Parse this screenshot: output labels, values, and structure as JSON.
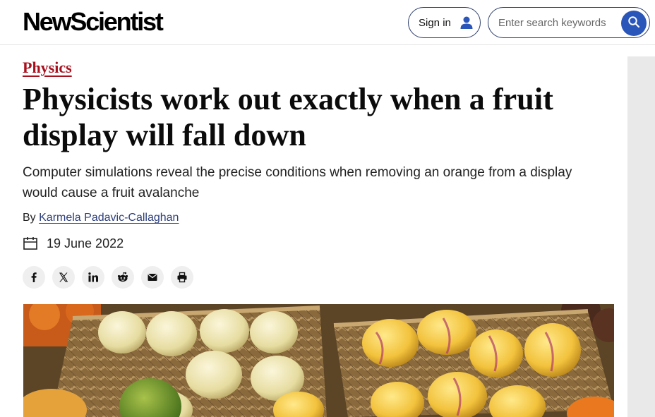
{
  "header": {
    "logo_text": "NewScientist",
    "signin_label": "Sign in",
    "search_placeholder": "Enter search keywords"
  },
  "article": {
    "category": "Physics",
    "headline": "Physicists work out exactly when a fruit display will fall down",
    "standfirst": "Computer simulations reveal the precise conditions when removing an orange from a display would cause a fruit avalanche",
    "byline_prefix": "By ",
    "author": "Karmela Padavic-Callaghan",
    "date": "19 June 2022"
  },
  "share": {
    "icons": [
      "facebook-icon",
      "x-icon",
      "linkedin-icon",
      "reddit-icon",
      "email-icon",
      "print-icon"
    ]
  },
  "colors": {
    "category_red": "#a8101e",
    "brand_navy": "#2d3e6b",
    "search_button_blue": "#2b56b9",
    "author_link": "#2d3e7a"
  }
}
